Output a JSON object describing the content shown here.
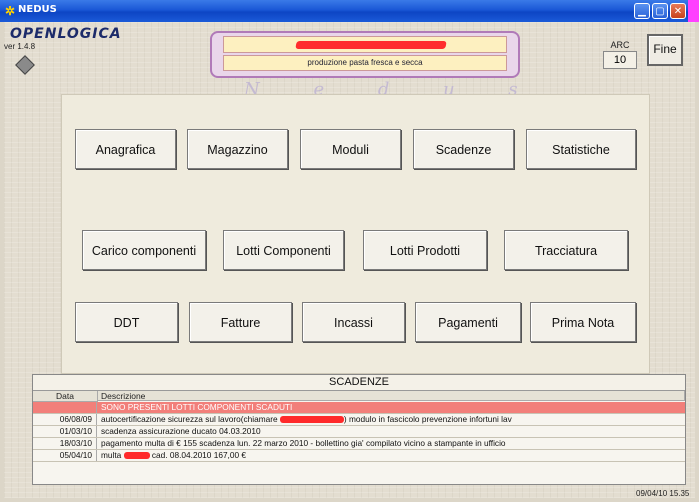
{
  "window": {
    "title": "NEDUS",
    "icon": "nedus-app-icon",
    "controls": [
      "minimize-icon",
      "maximize-icon",
      "close-icon"
    ]
  },
  "header": {
    "logo": "OPENLOGICA",
    "version": "ver 1.4.8",
    "company_subtitle": "produzione pasta fresca e secca",
    "watermark": "N e d u s",
    "arc_label": "ARC",
    "arc_value": "10",
    "fine_label": "Fine"
  },
  "menu": {
    "row1": [
      "Anagrafica",
      "Magazzino",
      "Moduli",
      "Scadenze",
      "Statistiche"
    ],
    "row2": [
      "Carico componenti",
      "Lotti Componenti",
      "Lotti Prodotti",
      "Tracciatura"
    ],
    "row3": [
      "DDT",
      "Fatture",
      "Incassi",
      "Pagamenti",
      "Prima Nota"
    ]
  },
  "scadenze": {
    "title": "SCADENZE",
    "columns": [
      "Data",
      "Descrizione"
    ],
    "alert": "SONO PRESENTI LOTTI COMPONENTI SCADUTI",
    "rows": [
      {
        "date": "06/08/09",
        "pre": "autocertificazione sicurezza sul lavoro(chiamare ",
        "post": ") modulo in fascicolo prevenzione infortuni lav"
      },
      {
        "date": "01/03/10",
        "pre": "scadenza assicurazione ducato 04.03.2010",
        "post": ""
      },
      {
        "date": "18/03/10",
        "pre": "pagamento multa di € 155 scadenza lun. 22 marzo 2010 - bollettino gia' compilato vicino a stampante in ufficio",
        "post": ""
      },
      {
        "date": "05/04/10",
        "pre": "multa ",
        "post": " cad. 08.04.2010 167,00 €"
      }
    ]
  },
  "status": {
    "datetime": "09/04/10 15.35"
  },
  "colors": {
    "titlebar": "#1a57d6",
    "alert_row": "#f27f7a",
    "header_border": "#b07ab8"
  }
}
